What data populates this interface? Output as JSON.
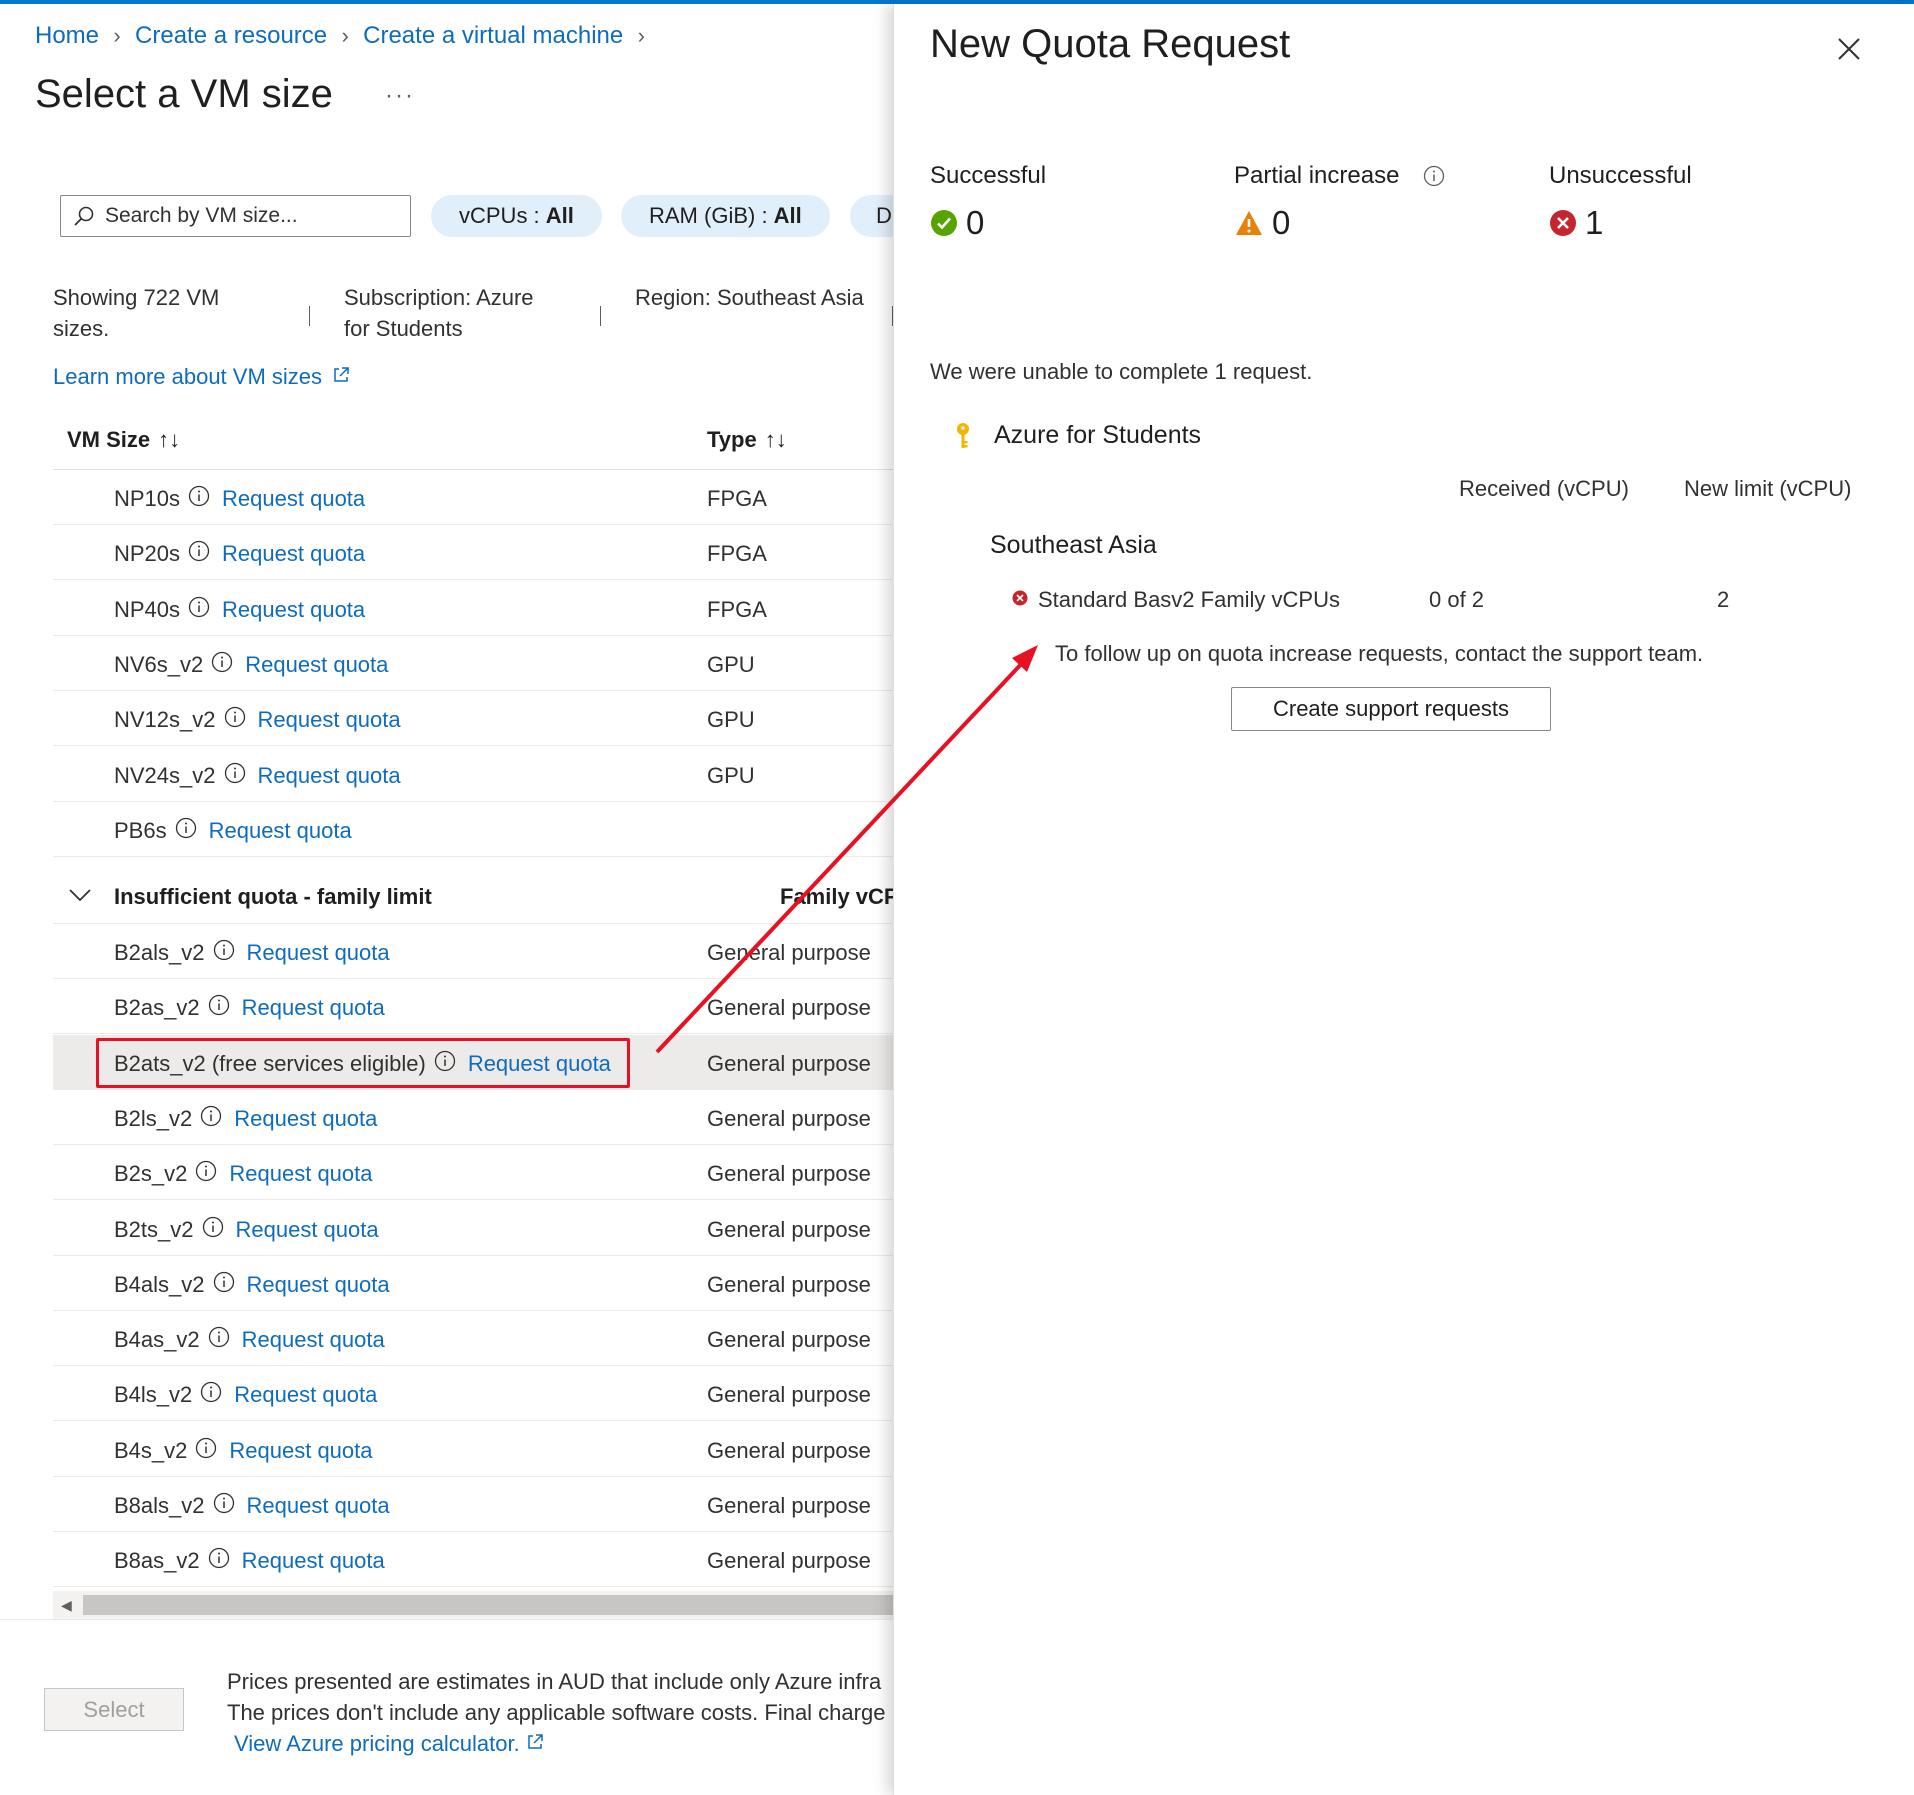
{
  "breadcrumb": [
    "Home",
    "Create a resource",
    "Create a virtual machine"
  ],
  "page": {
    "title": "Select a VM size",
    "more": "···"
  },
  "search": {
    "placeholder": "Search by VM size..."
  },
  "filters": [
    {
      "key": "vCPUs :",
      "value": "All"
    },
    {
      "key": "RAM (GiB) :",
      "value": "All"
    },
    {
      "key": "D",
      "value": ""
    }
  ],
  "info": {
    "showing": "Showing 722 VM sizes.",
    "subscription": "Subscription: Azure for Students",
    "region": "Region: Southeast Asia",
    "learn_more": "Learn more about VM sizes"
  },
  "table": {
    "headers": {
      "size": "VM Size",
      "type": "Type",
      "sort": "↑↓"
    },
    "quota_link": "Request quota",
    "rows": [
      {
        "name": "NP10s",
        "type": "FPGA"
      },
      {
        "name": "NP20s",
        "type": "FPGA"
      },
      {
        "name": "NP40s",
        "type": "FPGA"
      },
      {
        "name": "NV6s_v2",
        "type": "GPU"
      },
      {
        "name": "NV12s_v2",
        "type": "GPU"
      },
      {
        "name": "NV24s_v2",
        "type": "GPU"
      },
      {
        "name": "PB6s",
        "type": ""
      }
    ],
    "group": {
      "title": "Insufficient quota - family limit",
      "column": "Family vCP"
    },
    "group_rows": [
      {
        "name": "B2als_v2",
        "type": "General purpose"
      },
      {
        "name": "B2as_v2",
        "type": "General purpose"
      },
      {
        "name": "B2ats_v2 (free services eligible)",
        "type": "General purpose",
        "selected": true
      },
      {
        "name": "B2ls_v2",
        "type": "General purpose"
      },
      {
        "name": "B2s_v2",
        "type": "General purpose"
      },
      {
        "name": "B2ts_v2",
        "type": "General purpose"
      },
      {
        "name": "B4als_v2",
        "type": "General purpose"
      },
      {
        "name": "B4as_v2",
        "type": "General purpose"
      },
      {
        "name": "B4ls_v2",
        "type": "General purpose"
      },
      {
        "name": "B4s_v2",
        "type": "General purpose"
      },
      {
        "name": "B8als_v2",
        "type": "General purpose"
      },
      {
        "name": "B8as_v2",
        "type": "General purpose"
      }
    ]
  },
  "footer": {
    "select": "Select",
    "line1": "Prices presented are estimates in AUD that include only Azure infra",
    "line2": "The prices don't include any applicable software costs. Final charge",
    "calculator": "View Azure pricing calculator."
  },
  "panel": {
    "title": "New Quota Request",
    "stats": [
      {
        "label": "Successful",
        "value": "0",
        "status": "success"
      },
      {
        "label": "Partial increase",
        "value": "0",
        "status": "warning"
      },
      {
        "label": "Unsuccessful",
        "value": "1",
        "status": "error"
      }
    ],
    "message": "We were unable to complete 1 request.",
    "subscription": "Azure for Students",
    "columns": {
      "received": "Received (vCPU)",
      "new_limit": "New limit (vCPU)"
    },
    "region": "Southeast Asia",
    "quota": {
      "name": "Standard Basv2 Family vCPUs",
      "received": "0 of 2",
      "limit": "2"
    },
    "follow_up": "To follow up on quota increase requests, contact the support team.",
    "support_button": "Create support requests"
  },
  "colors": {
    "accent": "#0078d4",
    "link": "#0f6cbd",
    "success": "#57a300",
    "warning": "#e8800a",
    "error": "#c4262e",
    "annotation": "#e81123"
  }
}
